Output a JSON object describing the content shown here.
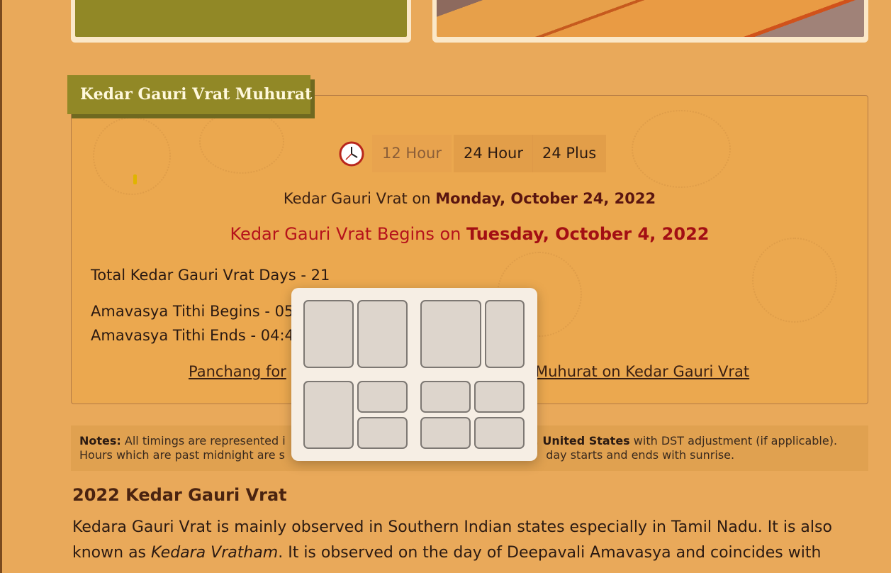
{
  "header": {
    "section_title": "Kedar Gauri Vrat Muhurat"
  },
  "time_format": {
    "options": [
      "12 Hour",
      "24 Hour",
      "24 Plus"
    ],
    "selected": "12 Hour"
  },
  "muhurat": {
    "date_prefix": "Kedar Gauri Vrat on",
    "date_value": "Monday, October 24, 2022",
    "begins_prefix": "Kedar Gauri Vrat Begins on",
    "begins_value": "Tuesday, October 4, 2022",
    "total_days": "Total Kedar Gauri Vrat Days - 21",
    "tithi_begins": "Amavasya Tithi Begins - 05",
    "tithi_ends": "Amavasya Tithi Ends - 04:4",
    "link_panchang": "Panchang for",
    "link_muhurat": "Muhurat on Kedar Gauri Vrat"
  },
  "notes": {
    "label": "Notes:",
    "text_start": "All timings are represented i",
    "location_bold": "a, United States",
    "text_end": "with DST adjustment (if applicable).",
    "line2_start": "Hours which are past midnight are s",
    "line2_end": "day starts and ends with sunrise."
  },
  "article": {
    "heading": "2022 Kedar Gauri Vrat",
    "para_part1": "Kedara Gauri Vrat is mainly observed in Southern Indian states especially in Tamil Nadu. It is also known as ",
    "para_italic": "Kedara Vratham",
    "para_part2": ". It is observed on the day of Deepavali Amavasya and coincides with"
  },
  "icons": {
    "clock": "clock-icon"
  },
  "colors": {
    "background": "#e9a95a",
    "tab_olive": "#918826",
    "highlight_red": "#b5121b",
    "popup_bg": "#f6eee4"
  }
}
